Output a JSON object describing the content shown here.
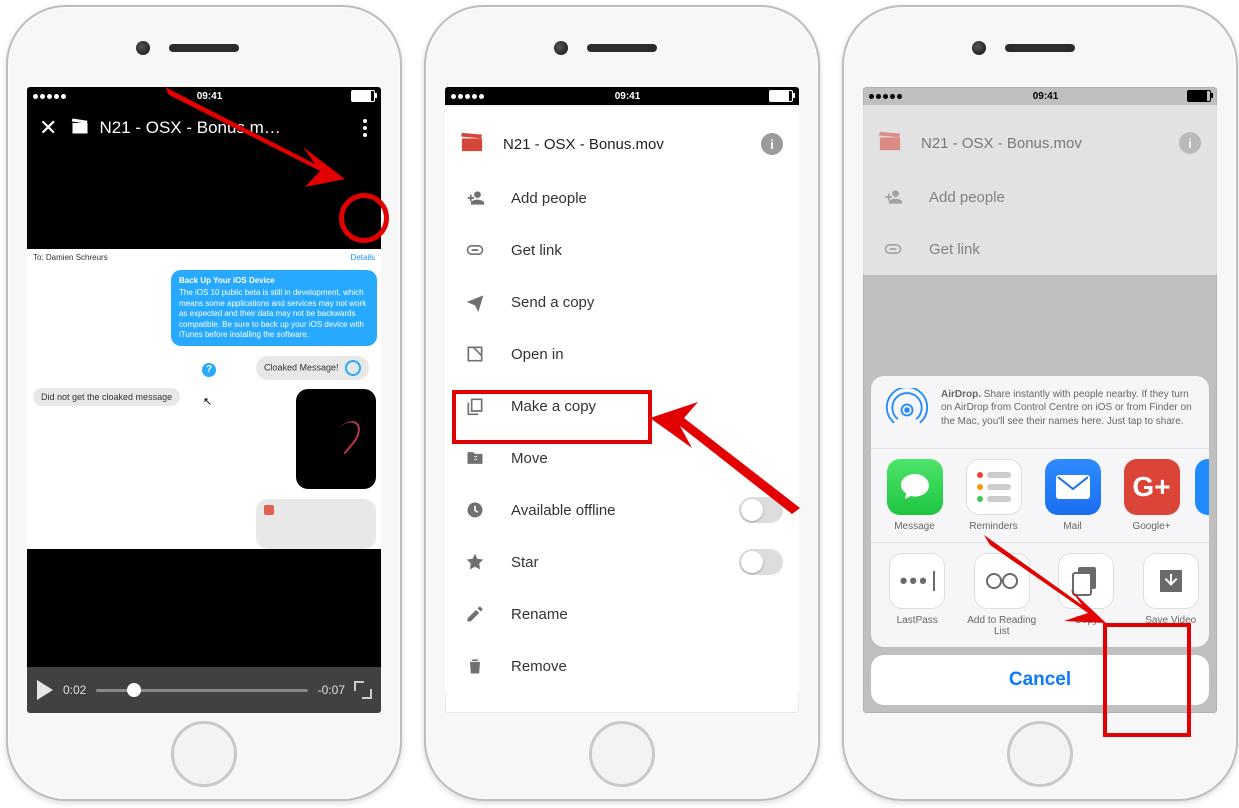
{
  "status": {
    "time": "09:41"
  },
  "phone1": {
    "title": "N21 - OSX - Bonus.m…",
    "chat": {
      "to_label": "To:",
      "to_name": "Damien Schreurs",
      "details_label": "Details",
      "blue_head": "Back Up Your iOS Device",
      "blue_body": "The iOS 10 public beta is still in development, which means some applications and services may not work as expected and their data may not be backwards compatible. Be sure to back up your iOS device with iTunes before installing the software.",
      "cloaked": "Cloaked Message!",
      "left_msg": "Did not get the cloaked message"
    },
    "player": {
      "elapsed": "0:02",
      "remaining": "-0:07"
    }
  },
  "menu": {
    "file_name": "N21 - OSX - Bonus.mov",
    "items": {
      "add_people": "Add people",
      "get_link": "Get link",
      "send_copy": "Send a copy",
      "open_in": "Open in",
      "make_copy": "Make a copy",
      "move": "Move",
      "available_offline": "Available offline",
      "star": "Star",
      "rename": "Rename",
      "remove": "Remove"
    }
  },
  "share": {
    "airdrop_title": "AirDrop.",
    "airdrop_body": " Share instantly with people nearby. If they turn on AirDrop from Control Centre on iOS or from Finder on the Mac, you'll see their names here. Just tap to share.",
    "apps": {
      "message": "Message",
      "reminders": "Reminders",
      "mail": "Mail",
      "gplus": "Google+"
    },
    "actions": {
      "lastpass": "LastPass",
      "add_reading": "Add to Reading List",
      "copy": "Copy",
      "save_video": "Save Video"
    },
    "cancel": "Cancel"
  }
}
